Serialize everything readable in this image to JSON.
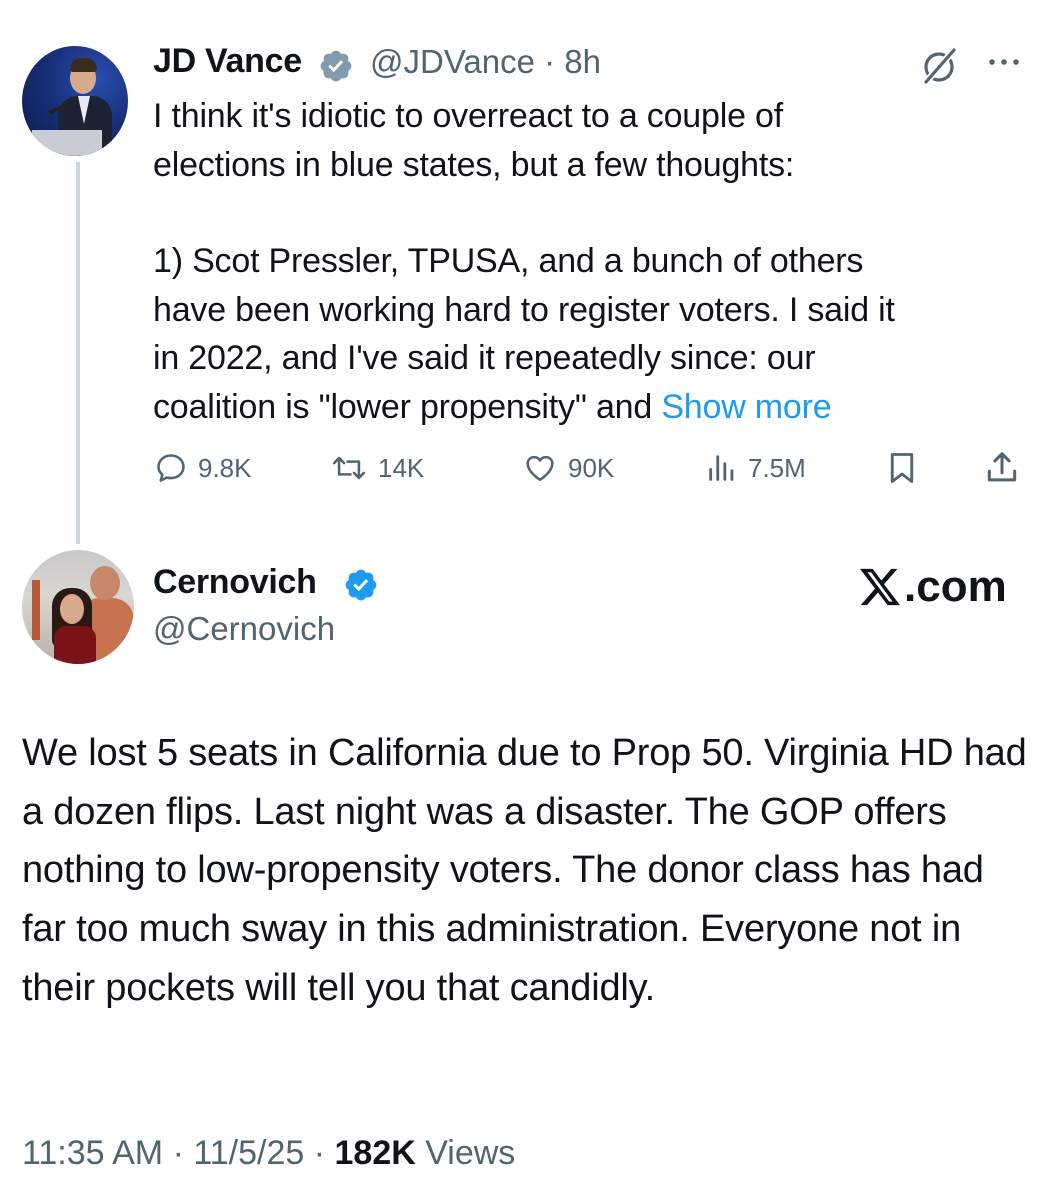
{
  "first_tweet": {
    "author_name": "JD Vance",
    "handle": "@JDVance",
    "time": "8h",
    "verified_color": "#829aab",
    "text_lines": [
      "I think it's idiotic to overreact to a couple of",
      "elections in blue states, but a few thoughts:"
    ],
    "text_lines_2": [
      "1) Scot Pressler, TPUSA, and a bunch of others",
      "have been working hard to register voters. I said it",
      "in 2022, and I've said it repeatedly since: our"
    ],
    "last_line_prefix": "coalition is \"lower propensity\" and ",
    "show_more": "Show more",
    "actions": {
      "replies": "9.8K",
      "reposts": "14K",
      "likes": "90K",
      "views": "7.5M"
    },
    "icons": [
      "grok-icon",
      "more-icon",
      "reply-icon",
      "repost-icon",
      "like-icon",
      "views-icon",
      "bookmark-icon",
      "share-icon"
    ]
  },
  "second_tweet": {
    "author_name": "Cernovich",
    "handle": "@Cernovich",
    "verified_color": "#1d9bf0",
    "watermark": ".com",
    "text": "We lost 5 seats in California due to Prop 50. Virginia HD had a dozen flips. Last night was a disaster. The GOP offers nothing to low-propensity voters. The donor class has had far too much sway in this administration. Everyone not in their pockets will tell you that candidly.",
    "footer": {
      "time": "11:35 AM",
      "separator": " · ",
      "date": "11/5/25",
      "views_count": "182K",
      "views_label": " Views"
    }
  },
  "colors": {
    "text": "#0f1419",
    "secondary": "#536471",
    "link": "#1d9bf0",
    "thread_line": "#cfd9de"
  }
}
